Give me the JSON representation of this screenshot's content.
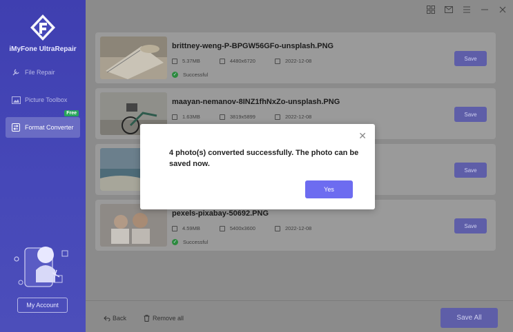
{
  "app": {
    "brand": "iMyFone UltraRepair"
  },
  "sidebar": {
    "items": [
      {
        "label": "File Repair",
        "icon": "wrench-icon"
      },
      {
        "label": "Picture Toolbox",
        "icon": "picture-icon"
      },
      {
        "label": "Format Converter",
        "icon": "convert-icon",
        "badge": "Free"
      }
    ],
    "my_account": "My Account"
  },
  "files": [
    {
      "name": "brittney-weng-P-BPGW56GFo-unsplash.PNG",
      "size": "5.37MB",
      "dimensions": "4480x6720",
      "date": "2022-12-08",
      "status": "Successful",
      "save_label": "Save"
    },
    {
      "name": "maayan-nemanov-8INZ1fhNxZo-unsplash.PNG",
      "size": "1.63MB",
      "dimensions": "3819x5899",
      "date": "2022-12-08",
      "save_label": "Save"
    },
    {
      "save_label": "Save"
    },
    {
      "name": "pexels-pixabay-50692.PNG",
      "size": "4.59MB",
      "dimensions": "5400x3600",
      "date": "2022-12-08",
      "status": "Successful",
      "save_label": "Save"
    }
  ],
  "bottom": {
    "back": "Back",
    "remove_all": "Remove all",
    "save_all": "Save All"
  },
  "modal": {
    "message": "4 photo(s) converted successfully. The photo can be saved now.",
    "yes": "Yes"
  },
  "colors": {
    "sidebar": "#4648b8",
    "accent": "#6d6cf0",
    "success": "#2d8a3e"
  }
}
